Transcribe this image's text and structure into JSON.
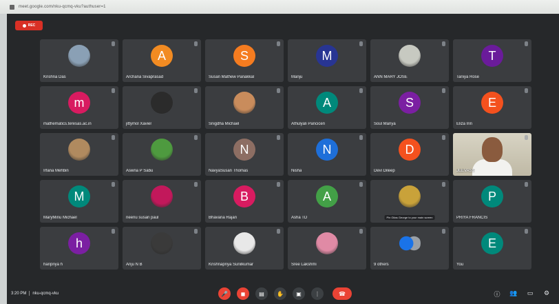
{
  "browser": {
    "url": "meet.google.com/nku-qcmq-vku?authuser=1"
  },
  "recording": {
    "label": "REC",
    "color": "#d93025"
  },
  "participants": [
    {
      "name": "Krishna Das",
      "type": "photo",
      "color": "#8aa0b5",
      "col": 0,
      "row": 0
    },
    {
      "name": "Archana Sivaprasad",
      "type": "initial",
      "initial": "A",
      "color": "#f28b22",
      "col": 1,
      "row": 0
    },
    {
      "name": "Susan Mathew Panakkal",
      "type": "initial",
      "initial": "S",
      "color": "#f57c20",
      "col": 2,
      "row": 0
    },
    {
      "name": "Manju",
      "type": "initial",
      "initial": "M",
      "color": "#283593",
      "col": 3,
      "row": 0
    },
    {
      "name": "ANN MARY JOSE",
      "type": "photo",
      "color": "#c7c9c1",
      "col": 4,
      "row": 0
    },
    {
      "name": "Taniya Rose",
      "type": "initial",
      "initial": "T",
      "color": "#6a1b9a",
      "col": 5,
      "row": 0
    },
    {
      "name": "mathematics.teresas.ac.in",
      "type": "initial",
      "initial": "m",
      "color": "#d81b60",
      "col": 0,
      "row": 1
    },
    {
      "name": "jittymol Xavier",
      "type": "photo",
      "color": "#2b2b2b",
      "col": 1,
      "row": 1
    },
    {
      "name": "Snigdha Michael",
      "type": "photo",
      "color": "#c98c5c",
      "col": 2,
      "row": 1
    },
    {
      "name": "Athulyali Pancicen",
      "type": "initial",
      "initial": "A",
      "color": "#00897b",
      "col": 3,
      "row": 1
    },
    {
      "name": "Soul Mariya",
      "type": "initial",
      "initial": "S",
      "color": "#7b1fa2",
      "col": 4,
      "row": 1
    },
    {
      "name": "Eliza Irin",
      "type": "initial",
      "initial": "E",
      "color": "#f4511e",
      "col": 5,
      "row": 1
    },
    {
      "name": "Irfana Mehbin",
      "type": "photo",
      "color": "#b08a5f",
      "col": 0,
      "row": 2
    },
    {
      "name": "Aswna P Sabu",
      "type": "photo",
      "color": "#4e9a3f",
      "col": 1,
      "row": 2
    },
    {
      "name": "NavyaSusan Thomas",
      "type": "initial",
      "initial": "N",
      "color": "#8d6e63",
      "col": 2,
      "row": 2
    },
    {
      "name": "Nisha",
      "type": "initial",
      "initial": "N",
      "color": "#1e6fd9",
      "col": 3,
      "row": 2
    },
    {
      "name": "Devi Dileep",
      "type": "initial",
      "initial": "D",
      "color": "#f4511e",
      "col": 4,
      "row": 2
    },
    {
      "name": "JEEVASS",
      "type": "video",
      "col": 5,
      "row": 2
    },
    {
      "name": "MaryMinu Michael",
      "type": "initial",
      "initial": "M",
      "color": "#00897b",
      "col": 0,
      "row": 3
    },
    {
      "name": "neenu susan paul",
      "type": "photo",
      "color": "#c2185b",
      "col": 1,
      "row": 3
    },
    {
      "name": "Bhavana Rajan",
      "type": "initial",
      "initial": "B",
      "color": "#d81b60",
      "col": 2,
      "row": 3
    },
    {
      "name": "Asha TD",
      "type": "initial",
      "initial": "A",
      "color": "#43a047",
      "col": 3,
      "row": 3
    },
    {
      "name": "",
      "type": "photo",
      "color": "#c9a23a",
      "col": 4,
      "row": 3,
      "tooltip": "Pin Gitas George to your main screen"
    },
    {
      "name": "PRIYA FRANCIS",
      "type": "initial",
      "initial": "P",
      "color": "#00897b",
      "col": 5,
      "row": 3
    },
    {
      "name": "haripriya h",
      "type": "initial",
      "initial": "h",
      "color": "#7b1fa2",
      "col": 0,
      "row": 4
    },
    {
      "name": "Anju N B",
      "type": "photo",
      "color": "#3a3a3a",
      "col": 1,
      "row": 4
    },
    {
      "name": "Krishnapriya Sunilkumar",
      "type": "photo",
      "color": "#e8e8e8",
      "col": 2,
      "row": 4
    },
    {
      "name": "Sree Lakshmi",
      "type": "photo",
      "color": "#e08aa5",
      "col": 3,
      "row": 4
    },
    {
      "name": "9 others",
      "type": "group",
      "color": "#5f6368",
      "col": 4,
      "row": 4
    },
    {
      "name": "You",
      "type": "initial",
      "initial": "E",
      "color": "#00897b",
      "col": 5,
      "row": 4
    }
  ],
  "bottom_bar": {
    "time": "3:20 PM",
    "meeting_code": "nku-qcmq-vku",
    "controls": [
      {
        "id": "mic",
        "icon": "mic-off-icon",
        "glyph": "🎤",
        "style": "red"
      },
      {
        "id": "camera",
        "icon": "camera-off-icon",
        "glyph": "◼",
        "style": "red"
      },
      {
        "id": "captions",
        "icon": "captions-icon",
        "glyph": "▤",
        "style": "gray"
      },
      {
        "id": "hand",
        "icon": "raise-hand-icon",
        "glyph": "✋",
        "style": "gray"
      },
      {
        "id": "present",
        "icon": "present-screen-icon",
        "glyph": "▣",
        "style": "gray"
      },
      {
        "id": "more",
        "icon": "more-options-icon",
        "glyph": "⋮",
        "style": "gray"
      },
      {
        "id": "hangup",
        "icon": "hang-up-icon",
        "glyph": "☎",
        "style": "hang"
      }
    ],
    "right_icons": [
      {
        "id": "info",
        "icon": "info-icon",
        "glyph": "ⓘ"
      },
      {
        "id": "people",
        "icon": "people-icon",
        "glyph": "👥"
      },
      {
        "id": "chat",
        "icon": "chat-icon",
        "glyph": "▭"
      },
      {
        "id": "activities",
        "icon": "activities-icon",
        "glyph": "⚙"
      }
    ]
  }
}
